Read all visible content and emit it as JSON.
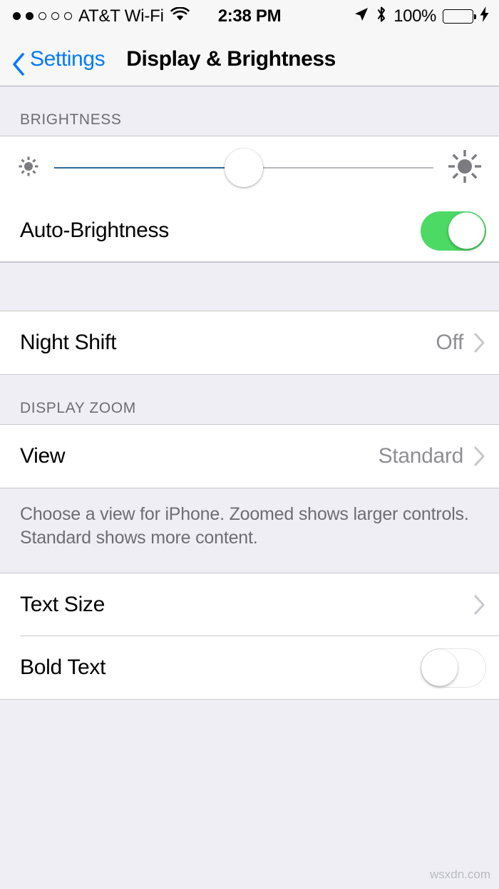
{
  "status_bar": {
    "signal_dots_filled": 2,
    "signal_dots_total": 5,
    "carrier": "AT&T Wi-Fi",
    "wifi_icon": "wifi-icon",
    "time": "2:38 PM",
    "location_icon": "location-arrow-icon",
    "bluetooth_icon": "bluetooth-icon",
    "battery_percent": "100%",
    "battery_fill_pct": 100,
    "battery_color": "#4cd964",
    "charging_icon": "lightning-bolt-icon"
  },
  "nav": {
    "back_label": "Settings",
    "back_icon": "chevron-left-icon",
    "title": "Display & Brightness",
    "tint_color": "#047aff"
  },
  "sections": {
    "brightness": {
      "header": "BRIGHTNESS",
      "slider": {
        "low_icon": "sun-small-icon",
        "high_icon": "sun-large-icon",
        "value_pct": 50,
        "fill_color": "#2e6a96",
        "track_color": "#b9b9bd"
      },
      "auto_brightness": {
        "label": "Auto-Brightness",
        "toggle_state": "on",
        "on_color": "#4cd964"
      }
    },
    "night_shift": {
      "label": "Night Shift",
      "value": "Off",
      "accessory_icon": "chevron-right-icon"
    },
    "display_zoom": {
      "header": "DISPLAY ZOOM",
      "view": {
        "label": "View",
        "value": "Standard",
        "accessory_icon": "chevron-right-icon"
      },
      "footer": "Choose a view for iPhone. Zoomed shows larger controls. Standard shows more content."
    },
    "text": {
      "text_size": {
        "label": "Text Size",
        "accessory_icon": "chevron-right-icon"
      },
      "bold_text": {
        "label": "Bold Text",
        "toggle_state": "off"
      }
    }
  },
  "watermark": "wsxdn.com"
}
